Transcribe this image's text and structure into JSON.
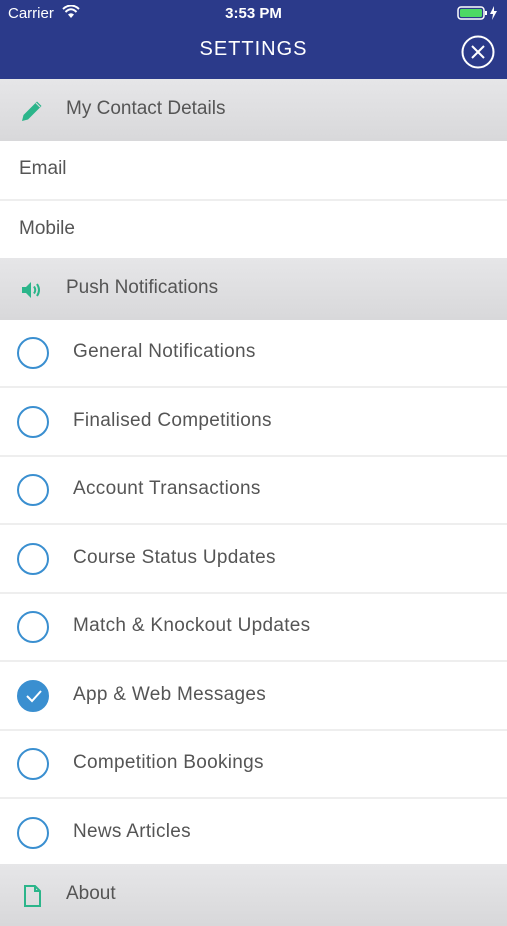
{
  "status_bar": {
    "carrier": "Carrier",
    "time": "3:53 PM"
  },
  "header": {
    "title": "SETTINGS"
  },
  "contact_section": {
    "label": "My Contact Details",
    "icon": "pencil-icon",
    "fields": [
      "Email",
      "Mobile"
    ]
  },
  "push_section": {
    "label": "Push Notifications",
    "icon": "speaker-icon"
  },
  "notifications": [
    {
      "label": "General Notifications",
      "checked": false
    },
    {
      "label": "Finalised Competitions",
      "checked": false
    },
    {
      "label": "Account Transactions",
      "checked": false
    },
    {
      "label": "Course Status Updates",
      "checked": false
    },
    {
      "label": "Match & Knockout Updates",
      "checked": false
    },
    {
      "label": "App & Web Messages",
      "checked": true
    },
    {
      "label": "Competition Bookings",
      "checked": false
    },
    {
      "label": "News Articles",
      "checked": false
    }
  ],
  "about_section": {
    "label": "About",
    "icon": "document-icon"
  },
  "colors": {
    "header_bg": "#2b3a8a",
    "accent": "#3a8fd0",
    "section_icon": "#2bb58a"
  }
}
